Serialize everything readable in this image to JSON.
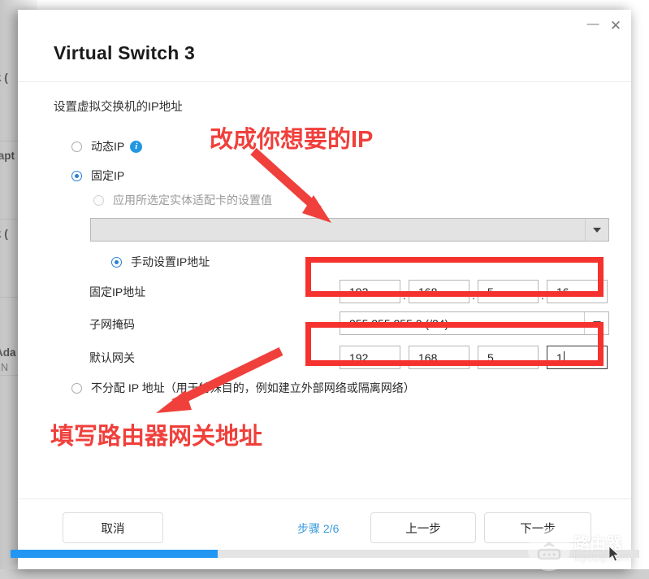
{
  "background": {
    "rows": [
      {
        "line1": "k (",
        "line2": ""
      },
      {
        "line1": "lapt",
        "line2": ")"
      },
      {
        "line1": "k (",
        "line2": ""
      },
      {
        "line1": "Ada",
        "line2": ", N"
      }
    ]
  },
  "dialog": {
    "title": "Virtual Switch 3",
    "subtitle": "设置虚拟交换机的IP地址",
    "window_buttons": {
      "minimize": "—",
      "minimize_icon": "minimize-icon",
      "close": "✕",
      "close_icon": "close-icon"
    },
    "options": {
      "dynamic_ip": {
        "label": "动态IP",
        "checked": false,
        "info_icon": "info-icon",
        "info_glyph": "i"
      },
      "static_ip": {
        "label": "固定IP",
        "checked": true
      },
      "apply_adapter": {
        "label": "应用所选定实体适配卡的设置值",
        "checked": false,
        "disabled": true
      },
      "adapter_combo_value": "",
      "manual_ip": {
        "label": "手动设置IP地址",
        "checked": true
      },
      "no_ip": {
        "label": "不分配 IP 地址（用于特殊目的，例如建立外部网络或隔离网络）",
        "checked": false
      }
    },
    "fields": {
      "ip_label": "固定IP地址",
      "ip_octets": [
        "192",
        "168",
        "5",
        "16"
      ],
      "mask_label": "子网掩码",
      "mask_value": "255.255.255.0 (/24)",
      "gateway_label": "默认网关",
      "gateway_octets": [
        "192",
        "168",
        "5",
        "1"
      ],
      "separator": "."
    },
    "footer": {
      "cancel": "取消",
      "step_text": "步骤 2/6",
      "back": "上一步",
      "next": "下一步"
    },
    "progress": {
      "percent": 33
    }
  },
  "annotations": [
    {
      "text": "改成你想要的IP",
      "name": "annotation-change-ip"
    },
    {
      "text": "填写路由器网关地址",
      "name": "annotation-gateway"
    }
  ],
  "watermark": {
    "title": "路由器",
    "subtitle": "luyouqi.com",
    "icon": "router-icon"
  },
  "colors": {
    "accent": "#2196f3",
    "annotation_red": "#f0403c",
    "highlight_red": "#f5322e",
    "step_blue": "#3a9ae0"
  }
}
